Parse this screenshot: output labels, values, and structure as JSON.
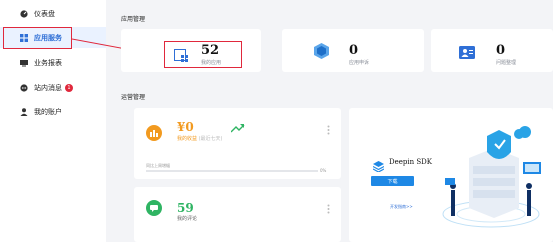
{
  "sidebar": {
    "items": [
      {
        "label": "仪表盘",
        "icon": "dashboard-icon"
      },
      {
        "label": "应用服务",
        "icon": "apps-grid-icon"
      },
      {
        "label": "业务报表",
        "icon": "report-icon"
      },
      {
        "label": "站内消息",
        "icon": "message-icon",
        "badge": "1"
      },
      {
        "label": "我的账户",
        "icon": "user-icon"
      }
    ],
    "active_index": 1
  },
  "app_management": {
    "title": "应用管理",
    "cards": [
      {
        "value": "52",
        "label": "我的应用"
      },
      {
        "value": "0",
        "label": "应用申诉"
      },
      {
        "value": "0",
        "label": "问题整理"
      }
    ]
  },
  "operations": {
    "title": "运营管理",
    "income": {
      "value": "¥0",
      "label": "我的收益",
      "sublabel": "(最近七天)",
      "progress_label": "同比上周增幅",
      "progress_value": "0%"
    },
    "comments": {
      "value": "59",
      "label": "我的评论"
    },
    "sdk": {
      "title": "Deepin SDK",
      "button": "下载",
      "link": "开发指南>>"
    }
  },
  "colors": {
    "accent": "#2f6fd6",
    "highlight": "#e0283c",
    "orange": "#f29a1f",
    "green": "#2fb463",
    "sdk_blue": "#1e88e5"
  }
}
